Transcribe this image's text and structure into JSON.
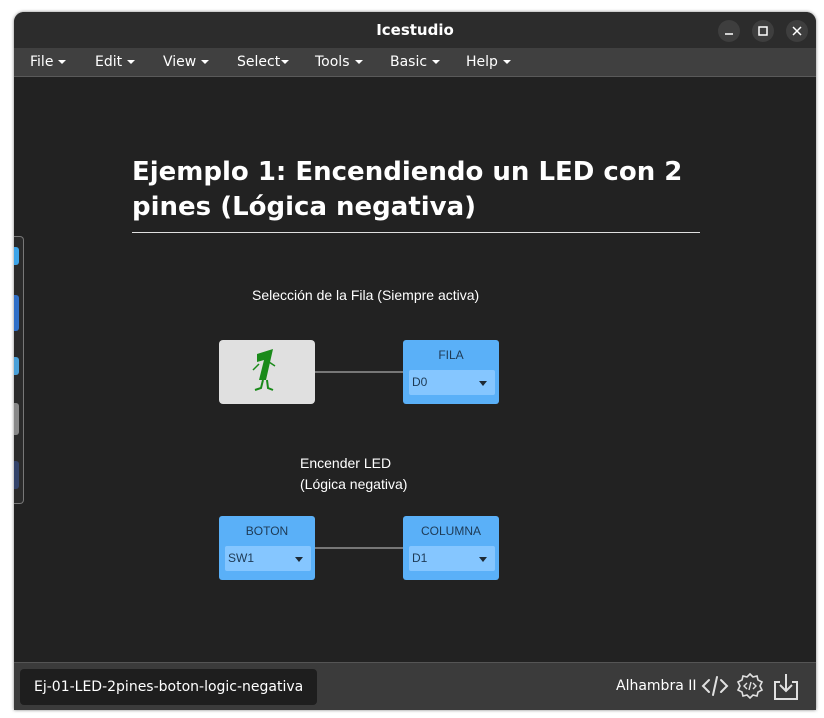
{
  "window": {
    "title": "Icestudio"
  },
  "menu": [
    {
      "label": "File"
    },
    {
      "label": "Edit"
    },
    {
      "label": "View"
    },
    {
      "label": "Select"
    },
    {
      "label": "Tools"
    },
    {
      "label": "Basic"
    },
    {
      "label": "Help"
    }
  ],
  "canvas": {
    "heading": "Ejemplo 1: Encendiendo un LED con 2 pines (Lógica negativa)",
    "note_row": "Selección de la Fila (Siempre activa)",
    "note_led_line1": "Encender LED",
    "note_led_line2": "(Lógica negativa)",
    "blocks": {
      "fila": {
        "label": "FILA",
        "value": "D0"
      },
      "boton": {
        "label": "BOTON",
        "value": "SW1"
      },
      "columna": {
        "label": "COLUMNA",
        "value": "D1"
      }
    },
    "constant_icon": "walking-one-constant-icon"
  },
  "footer": {
    "file_tab": "Ej-01-LED-2pines-boton-logic-negativa",
    "board": "Alhambra II",
    "icons": [
      "code-icon",
      "gear-code-icon",
      "download-icon"
    ]
  },
  "colors": {
    "block_blue": "#5ab0f8",
    "select_blue": "#85c6ff",
    "canvas_bg": "#222222",
    "constant_green": "#1a8a1a"
  }
}
